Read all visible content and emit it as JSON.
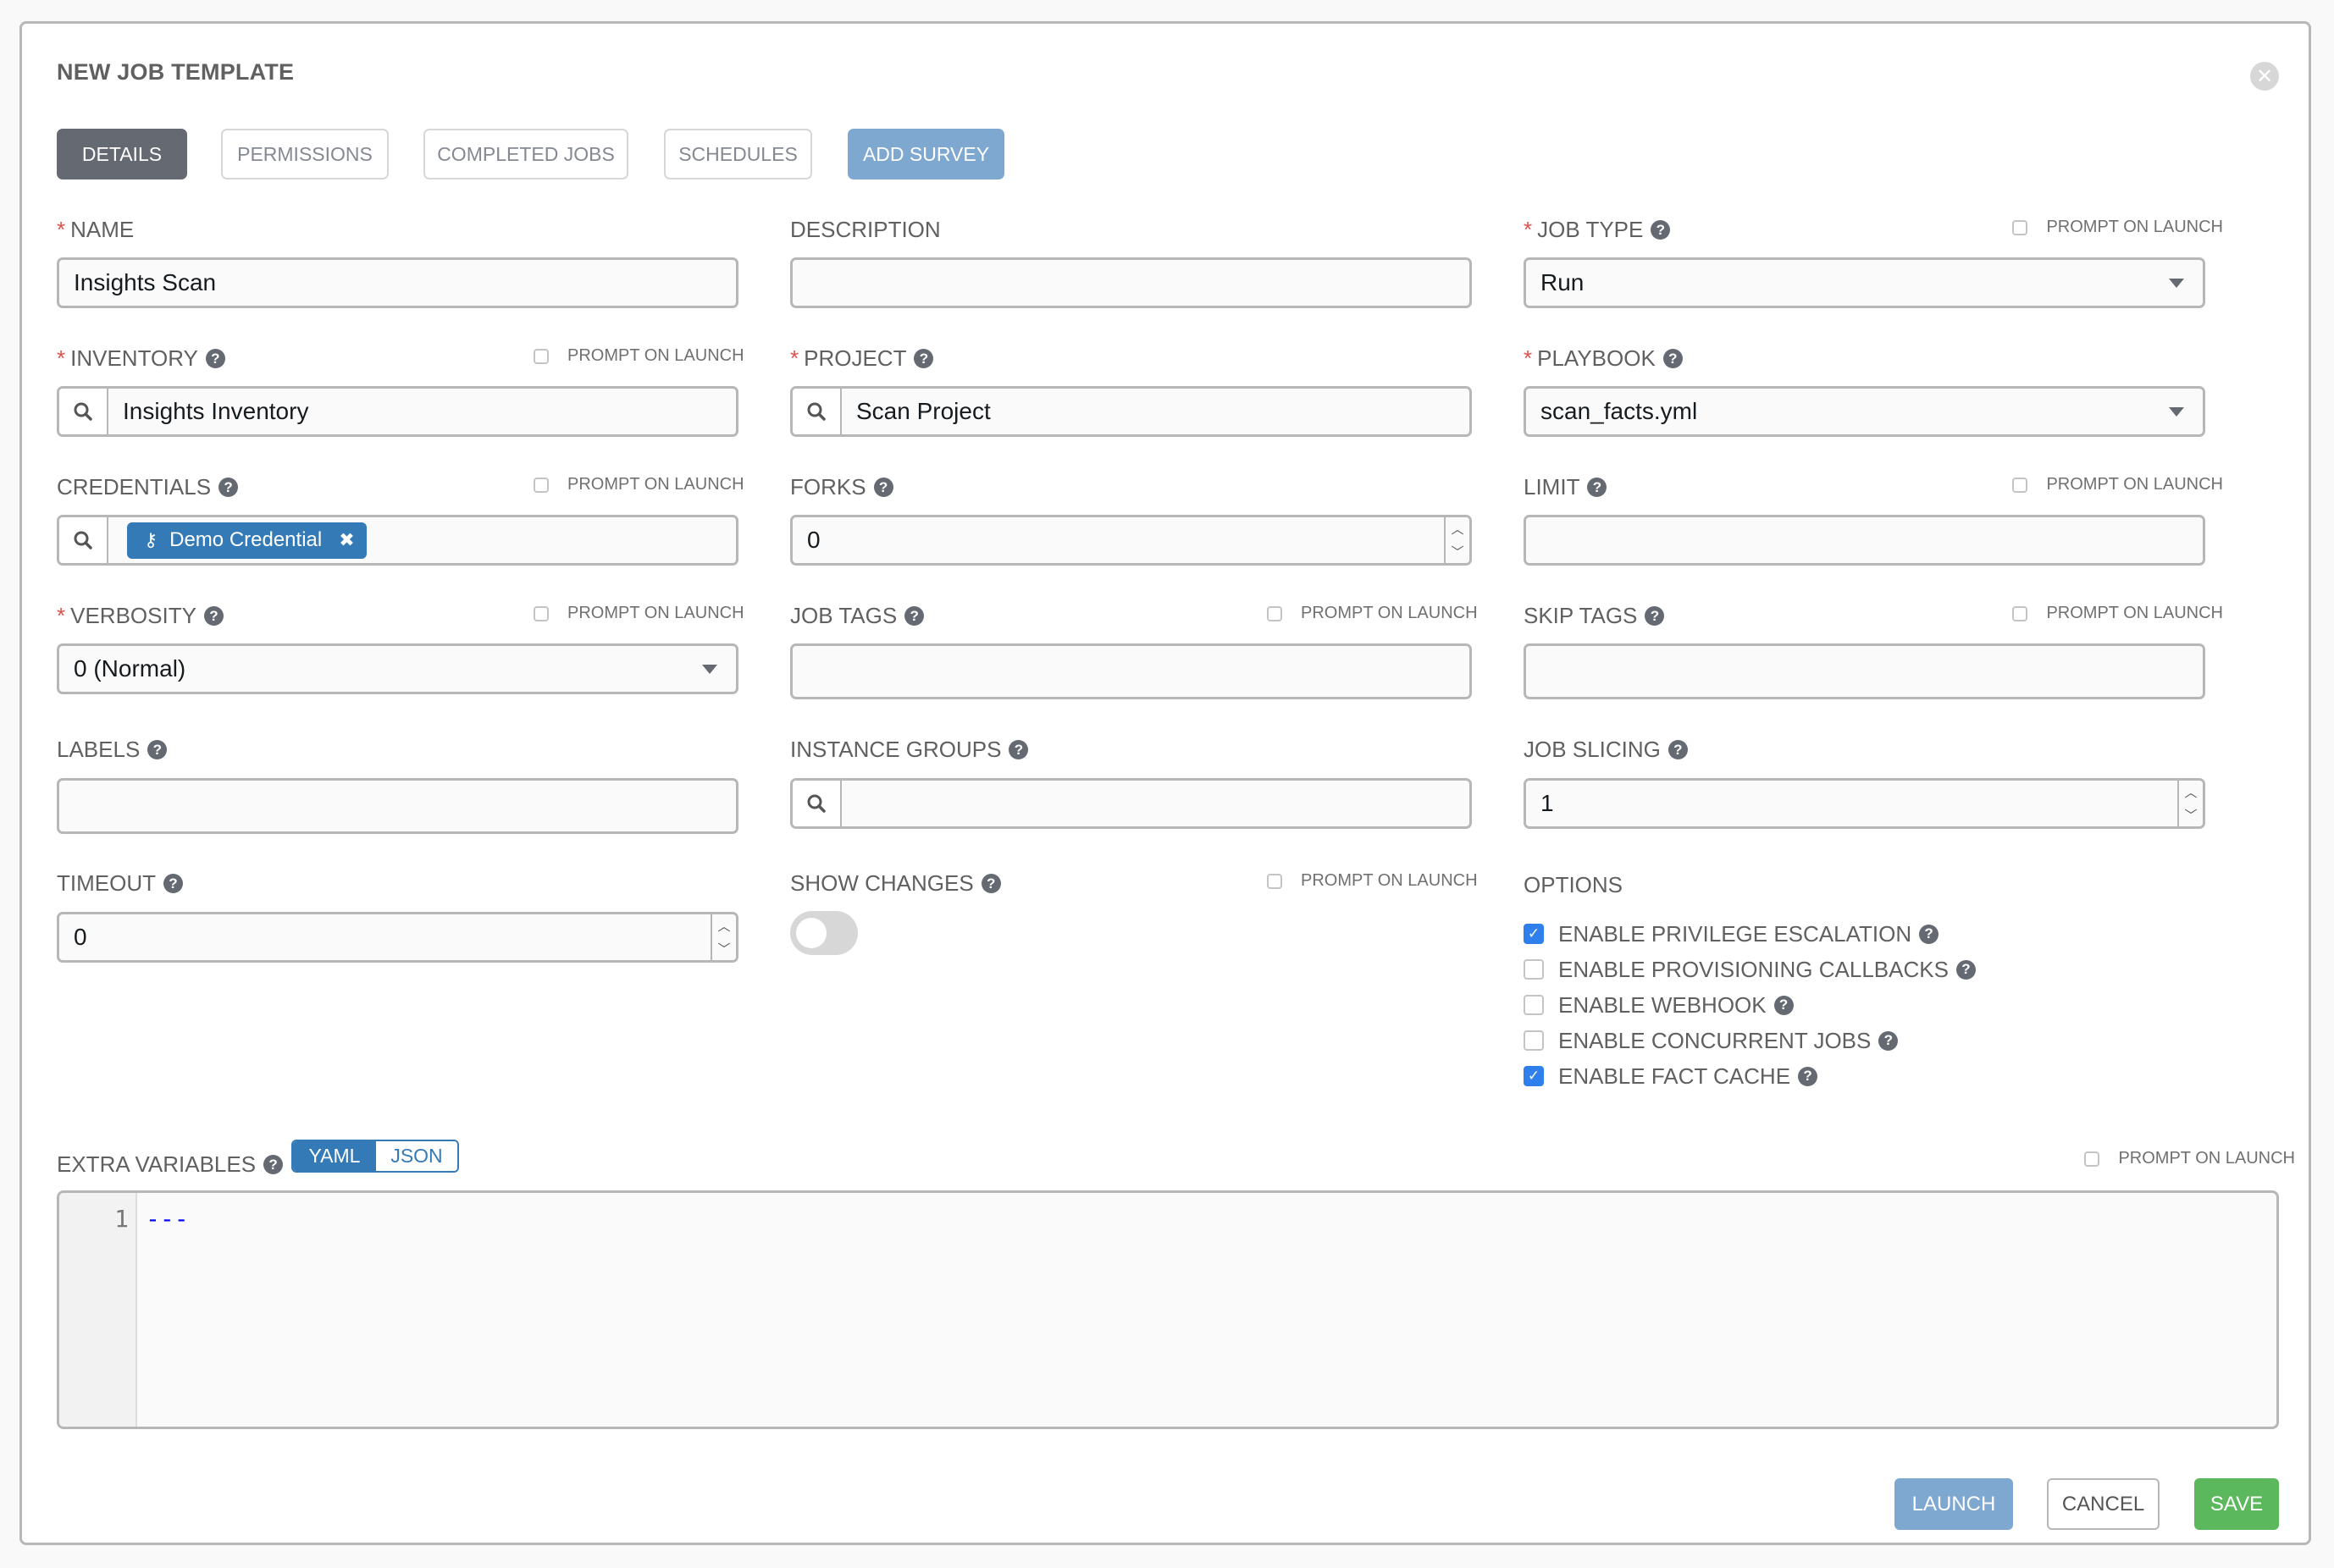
{
  "header": {
    "title": "NEW JOB TEMPLATE",
    "close_icon": "close-circle-icon"
  },
  "tabs": [
    {
      "label": "DETAILS",
      "state": "active"
    },
    {
      "label": "PERMISSIONS",
      "state": "disabled"
    },
    {
      "label": "COMPLETED JOBS",
      "state": "disabled"
    },
    {
      "label": "SCHEDULES",
      "state": "disabled"
    },
    {
      "label": "ADD SURVEY",
      "state": "primary-disabled"
    }
  ],
  "prompt_label": "PROMPT ON LAUNCH",
  "fields": {
    "name": {
      "label": "NAME",
      "required": true,
      "value": "Insights Scan"
    },
    "description": {
      "label": "DESCRIPTION",
      "value": ""
    },
    "job_type": {
      "label": "JOB TYPE",
      "required": true,
      "value": "Run",
      "prompt_on_launch": false
    },
    "inventory": {
      "label": "INVENTORY",
      "required": true,
      "value": "Insights Inventory",
      "prompt_on_launch": false
    },
    "project": {
      "label": "PROJECT",
      "required": true,
      "value": "Scan Project"
    },
    "playbook": {
      "label": "PLAYBOOK",
      "required": true,
      "value": "scan_facts.yml"
    },
    "credentials": {
      "label": "CREDENTIALS",
      "chips": [
        "Demo Credential"
      ],
      "prompt_on_launch": false
    },
    "forks": {
      "label": "FORKS",
      "value": "0"
    },
    "limit": {
      "label": "LIMIT",
      "value": "",
      "prompt_on_launch": false
    },
    "verbosity": {
      "label": "VERBOSITY",
      "required": true,
      "value": "0 (Normal)",
      "prompt_on_launch": false
    },
    "job_tags": {
      "label": "JOB TAGS",
      "value": "",
      "prompt_on_launch": false
    },
    "skip_tags": {
      "label": "SKIP TAGS",
      "value": "",
      "prompt_on_launch": false
    },
    "labels": {
      "label": "LABELS",
      "value": ""
    },
    "instance_groups": {
      "label": "INSTANCE GROUPS",
      "value": ""
    },
    "job_slicing": {
      "label": "JOB SLICING",
      "value": "1"
    },
    "timeout": {
      "label": "TIMEOUT",
      "value": "0"
    },
    "show_changes": {
      "label": "SHOW CHANGES",
      "enabled": false,
      "prompt_on_launch": false
    }
  },
  "options": {
    "label": "OPTIONS",
    "items": [
      {
        "label": "ENABLE PRIVILEGE ESCALATION",
        "checked": true
      },
      {
        "label": "ENABLE PROVISIONING CALLBACKS",
        "checked": false
      },
      {
        "label": "ENABLE WEBHOOK",
        "checked": false
      },
      {
        "label": "ENABLE CONCURRENT JOBS",
        "checked": false
      },
      {
        "label": "ENABLE FACT CACHE",
        "checked": true
      }
    ]
  },
  "extra_vars": {
    "label": "EXTRA VARIABLES",
    "modes": [
      "YAML",
      "JSON"
    ],
    "active_mode": "YAML",
    "prompt_on_launch": false,
    "lines": [
      {
        "number": "1",
        "text": "---"
      }
    ]
  },
  "actions": {
    "launch": "LAUNCH",
    "cancel": "CANCEL",
    "save": "SAVE"
  },
  "colors": {
    "primary": "#337ab7",
    "save": "#5cb85c",
    "launch_disabled": "#7fa8d1",
    "required": "#d9534f",
    "checkbox_on": "#2f80ed"
  }
}
